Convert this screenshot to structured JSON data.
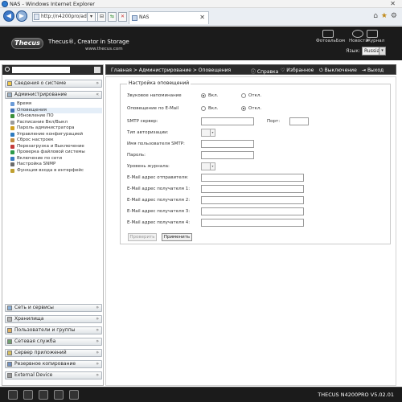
{
  "browser": {
    "window_title": "NAS - Windows Internet Explorer",
    "address": "http://n4200pro/adr",
    "tab_label": "NAS"
  },
  "header": {
    "tagline": "Thecus®, Creator in Storage",
    "website": "www.thecus.com",
    "logo_text": "Thecus",
    "icons": [
      {
        "name": "photo-album-icon",
        "label": "ФотоальБом"
      },
      {
        "name": "news-icon",
        "label": "Новости"
      },
      {
        "name": "log-icon",
        "label": "Журнал"
      }
    ],
    "language_label": "Язык:",
    "language_value": "Russia"
  },
  "sidebar": {
    "categories_top": [
      {
        "label": "Сведения о системе"
      },
      {
        "label": "Администрирование"
      }
    ],
    "admin_items": [
      {
        "label": "Время",
        "color": "#6a9bd8"
      },
      {
        "label": "Оповещения",
        "color": "#3f6fb5"
      },
      {
        "label": "Обновление ПО",
        "color": "#3a8f3a"
      },
      {
        "label": "Расписание Вкл/Выкл",
        "color": "#9b9b9b"
      },
      {
        "label": "Пароль администратора",
        "color": "#d0a020"
      },
      {
        "label": "Управление конфигурацией",
        "color": "#2e7bbf"
      },
      {
        "label": "Сброс настроек",
        "color": "#c08a40"
      },
      {
        "label": "Перезагрузка и Выключение",
        "color": "#c43c3c"
      },
      {
        "label": "Проверка файловой системы",
        "color": "#2e9a4a"
      },
      {
        "label": "Включение по сети",
        "color": "#3a7ac0"
      },
      {
        "label": "Настройка SNMP",
        "color": "#6b6b6b"
      },
      {
        "label": "Функция входа в интерфейс",
        "color": "#c0a030"
      }
    ],
    "categories_bottom": [
      {
        "label": "Сеть и сервисы"
      },
      {
        "label": "Хранилища"
      },
      {
        "label": "Пользователи и группы"
      },
      {
        "label": "Сетевая служба"
      },
      {
        "label": "Сервер приложений"
      },
      {
        "label": "Резервное копирование"
      },
      {
        "label": "External Device"
      }
    ]
  },
  "breadcrumb": {
    "path": "Главная > Администрирование > Оповещения",
    "actions": [
      {
        "label": "Справка"
      },
      {
        "label": "Избранное"
      },
      {
        "label": "Выключение"
      },
      {
        "label": "Выход"
      }
    ]
  },
  "form": {
    "legend": "Настройка оповещений",
    "beep_label": "Звуковое напоминание",
    "beep_on": "Вкл.",
    "beep_off": "Откл.",
    "beep_selected": "on",
    "email_label": "Оповещение по E-Mail",
    "email_on": "Вкл.",
    "email_off": "Откл.",
    "email_selected": "off",
    "smtp_server_label": "SMTP сервер:",
    "port_label": "Порт:",
    "auth_type_label": "Тип авторизации:",
    "smtp_user_label": "Имя пользователя SMTP:",
    "password_label": "Пароль:",
    "log_level_label": "Уровень журнала:",
    "sender_label": "E-Mail адрес отправителя:",
    "recipients": [
      {
        "label": "E-Mail адрес получателя 1:"
      },
      {
        "label": "E-Mail адрес получателя 2:"
      },
      {
        "label": "E-Mail адрес получателя 3:"
      },
      {
        "label": "E-Mail адрес получателя 4:"
      }
    ],
    "test_button": "Проверить",
    "apply_button": "Применить"
  },
  "statusbar": {
    "version": "THECUS N4200PRO V5.02.01"
  }
}
